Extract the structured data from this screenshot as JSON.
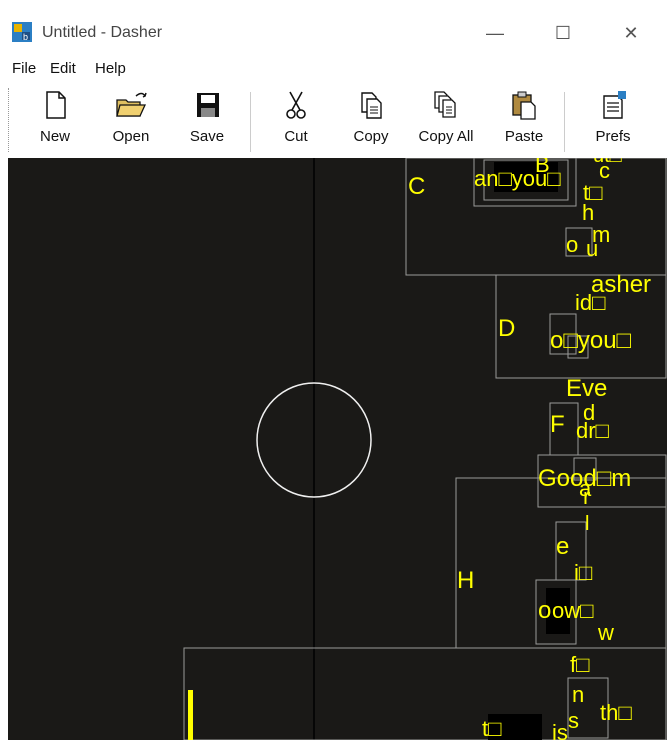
{
  "window": {
    "title": "Untitled - Dasher"
  },
  "menu": {
    "items": [
      "File",
      "Edit",
      "Help"
    ]
  },
  "toolbar": {
    "buttons": [
      {
        "label": "New",
        "icon": "new-file-icon"
      },
      {
        "label": "Open",
        "icon": "open-folder-icon"
      },
      {
        "label": "Save",
        "icon": "save-disk-icon"
      },
      {
        "label": "Cut",
        "icon": "scissors-icon"
      },
      {
        "label": "Copy",
        "icon": "copy-icon"
      },
      {
        "label": "Copy All",
        "icon": "copy-all-icon"
      },
      {
        "label": "Paste",
        "icon": "paste-icon"
      },
      {
        "label": "Prefs",
        "icon": "preferences-icon"
      }
    ]
  },
  "colors": {
    "canvas_bg": "#1a1917",
    "text": "#ffff00",
    "box": "#9a9a9a",
    "crosshair": "#000000"
  },
  "dasher": {
    "labels": [
      "C",
      "D",
      "F",
      "H",
      "an□you□",
      "B",
      "ut□",
      "c",
      "t□",
      "h",
      "m",
      "o",
      "u",
      "asher",
      "id□",
      "o□you□",
      "Eve",
      "d",
      "dr□",
      "Good□m",
      "r",
      "a",
      "l",
      "e",
      "i□",
      "o",
      "ow□",
      "w",
      "f□",
      "n",
      "s",
      "th□",
      "t□",
      "is"
    ]
  }
}
